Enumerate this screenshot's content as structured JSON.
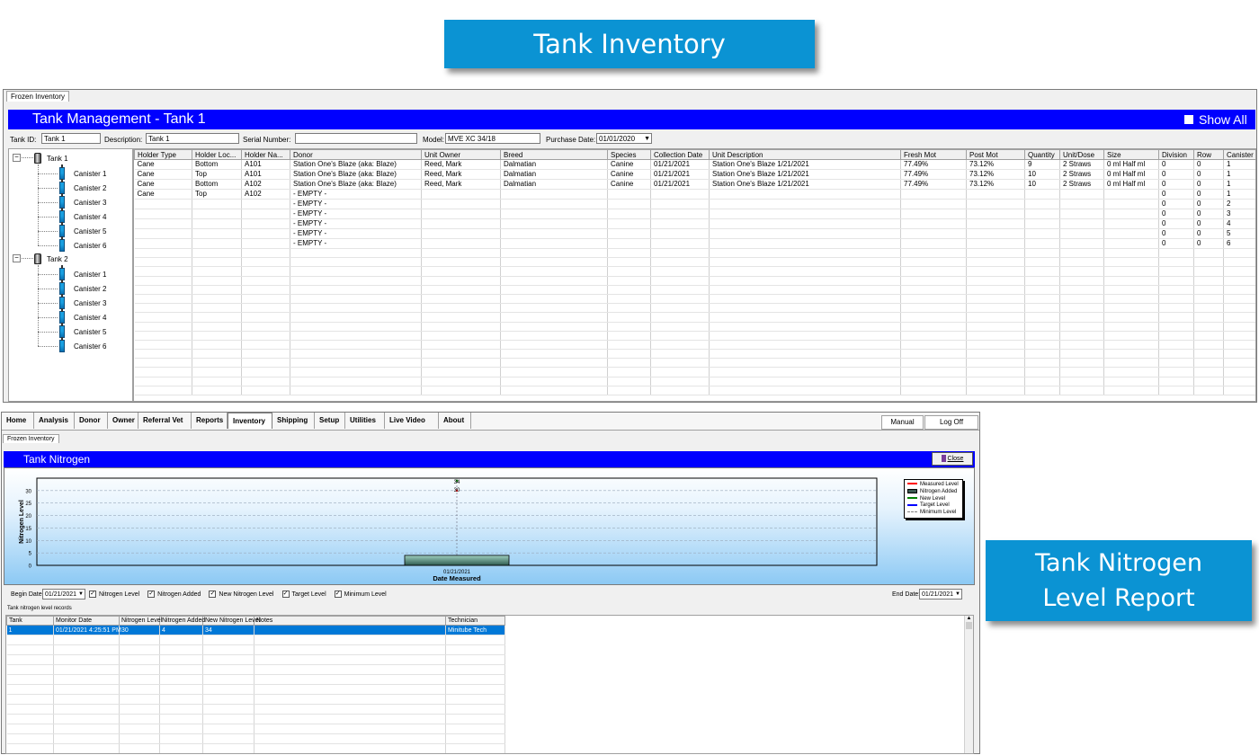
{
  "callouts": {
    "top": "Tank Inventory",
    "right_line1": "Tank Nitrogen",
    "right_line2": "Level Report"
  },
  "inventory": {
    "tab_label": "Frozen Inventory",
    "title": "Tank Management - Tank 1",
    "show_all_label": "Show All",
    "fields": {
      "tank_id_label": "Tank ID:",
      "tank_id_value": "Tank 1",
      "description_label": "Description:",
      "description_value": "Tank 1",
      "serial_label": "Serial Number:",
      "serial_value": "",
      "model_label": "Model:",
      "model_value": "MVE XC 34/18",
      "purchase_label": "Purchase Date:",
      "purchase_value": "01/01/2020"
    },
    "tree": [
      {
        "label": "Tank 1",
        "children": [
          "Canister 1",
          "Canister 2",
          "Canister 3",
          "Canister 4",
          "Canister 5",
          "Canister 6"
        ]
      },
      {
        "label": "Tank 2",
        "children": [
          "Canister 1",
          "Canister 2",
          "Canister 3",
          "Canister 4",
          "Canister 5",
          "Canister 6"
        ]
      }
    ],
    "columns": [
      "Holder Type",
      "Holder Loc...",
      "Holder Na...",
      "Donor",
      "Unit Owner",
      "Breed",
      "Species",
      "Collection Date",
      "Unit Description",
      "Fresh Mot",
      "Post Mot",
      "Quantity",
      "Unit/Dose",
      "Size",
      "Division",
      "Row",
      "Canister"
    ],
    "rows": [
      [
        "Cane",
        "Bottom",
        "A101",
        "Station One's Blaze (aka: Blaze)",
        "Reed, Mark",
        "Dalmatian",
        "Canine",
        "01/21/2021",
        "Station One's Blaze 1/21/2021",
        "77.49%",
        "73.12%",
        "9",
        "2 Straws",
        "0 ml Half ml",
        "0",
        "0",
        "1"
      ],
      [
        "Cane",
        "Top",
        "A101",
        "Station One's Blaze (aka: Blaze)",
        "Reed, Mark",
        "Dalmatian",
        "Canine",
        "01/21/2021",
        "Station One's Blaze 1/21/2021",
        "77.49%",
        "73.12%",
        "10",
        "2 Straws",
        "0 ml Half ml",
        "0",
        "0",
        "1"
      ],
      [
        "Cane",
        "Bottom",
        "A102",
        "Station One's Blaze (aka: Blaze)",
        "Reed, Mark",
        "Dalmatian",
        "Canine",
        "01/21/2021",
        "Station One's Blaze 1/21/2021",
        "77.49%",
        "73.12%",
        "10",
        "2 Straws",
        "0 ml Half ml",
        "0",
        "0",
        "1"
      ],
      [
        "Cane",
        "Top",
        "A102",
        "- EMPTY -",
        "",
        "",
        "",
        "",
        "",
        "",
        "",
        "",
        "",
        "",
        "0",
        "0",
        "1"
      ],
      [
        "",
        "",
        "",
        "- EMPTY -",
        "",
        "",
        "",
        "",
        "",
        "",
        "",
        "",
        "",
        "",
        "0",
        "0",
        "2"
      ],
      [
        "",
        "",
        "",
        "- EMPTY -",
        "",
        "",
        "",
        "",
        "",
        "",
        "",
        "",
        "",
        "",
        "0",
        "0",
        "3"
      ],
      [
        "",
        "",
        "",
        "- EMPTY -",
        "",
        "",
        "",
        "",
        "",
        "",
        "",
        "",
        "",
        "",
        "0",
        "0",
        "4"
      ],
      [
        "",
        "",
        "",
        "- EMPTY -",
        "",
        "",
        "",
        "",
        "",
        "",
        "",
        "",
        "",
        "",
        "0",
        "0",
        "5"
      ],
      [
        "",
        "",
        "",
        "- EMPTY -",
        "",
        "",
        "",
        "",
        "",
        "",
        "",
        "",
        "",
        "",
        "0",
        "0",
        "6"
      ]
    ]
  },
  "nitrogen": {
    "menu": [
      "Home",
      "Analysis",
      "Donor",
      "Owner",
      "Referral Vet",
      "Reports",
      "Inventory",
      "Shipping",
      "Setup",
      "Utilities",
      "Live Video",
      "About"
    ],
    "manual_label": "Manual",
    "logoff_label": "Log Off",
    "tab_label": "Frozen Inventory",
    "title": "Tank Nitrogen",
    "close_label": "Close",
    "legend": [
      "Measured Level",
      "Nitrogen Added",
      "New Level",
      "Target Level",
      "Minimum Level"
    ],
    "begin_date_label": "Begin Date:",
    "begin_date_value": "01/21/2021",
    "end_date_label": "End Date:",
    "end_date_value": "01/21/2021",
    "checkboxes": [
      "Nitrogen Level",
      "Nitrogen Added",
      "New Nitrogen Level",
      "Target Level",
      "Minimum Level"
    ],
    "records_caption": "Tank nitrogen level records",
    "record_columns": [
      "Tank",
      "Monitor Date",
      "Nitrogen Level",
      "Nitrogen Added",
      "New Nitrogen Level",
      "Notes",
      "Technician"
    ],
    "records": [
      [
        "1",
        "01/21/2021 4:25:51 PM",
        "30",
        "4",
        "34",
        "",
        "Minitube Tech"
      ]
    ]
  },
  "chart_data": {
    "type": "bar",
    "xlabel": "Date Measured",
    "ylabel": "Nitrogen Level",
    "ylim": [
      0,
      35
    ],
    "yticks": [
      0,
      5,
      10,
      15,
      20,
      25,
      30
    ],
    "categories": [
      "01/21/2021"
    ],
    "series": [
      {
        "name": "Measured Level",
        "values": [
          30
        ]
      },
      {
        "name": "Nitrogen Added",
        "values": [
          4
        ]
      },
      {
        "name": "New Level",
        "values": [
          34
        ]
      }
    ],
    "data_labels": [
      "34",
      "30"
    ],
    "grid": true,
    "legend_position": "top-right",
    "colors": {
      "measured": "#ff0000",
      "added": "#3c5a50",
      "new": "#008000",
      "target": "#0000ff",
      "minimum": "#808080"
    }
  }
}
